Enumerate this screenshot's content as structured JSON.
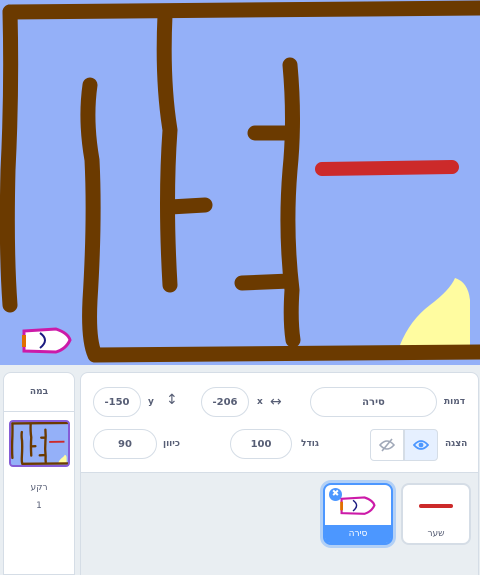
{
  "sprite_info": {
    "sprite_label": "דמות",
    "sprite_name": "סירה",
    "x_label": "x",
    "x_value": "-206",
    "y_label": "y",
    "y_value": "-150",
    "show_label": "הצגה",
    "size_label": "גודל",
    "size_value": "100",
    "direction_label": "כיוון",
    "direction_value": "90"
  },
  "sprites": [
    {
      "name": "שער",
      "selected": false
    },
    {
      "name": "סירה",
      "selected": true
    }
  ],
  "stage_panel": {
    "title": "במה",
    "backdrops_label": "רקע",
    "backdrops_count": "1"
  },
  "colors": {
    "stage_water": "#94b0f8",
    "wall": "#6b3a00",
    "gate": "#cc2a2a",
    "sand": "#fffca0",
    "accent": "#4c97ff"
  },
  "icons": [
    "x-arrows-icon",
    "y-arrows-icon",
    "show-eye-icon",
    "hide-eye-icon",
    "delete-sprite-icon"
  ]
}
